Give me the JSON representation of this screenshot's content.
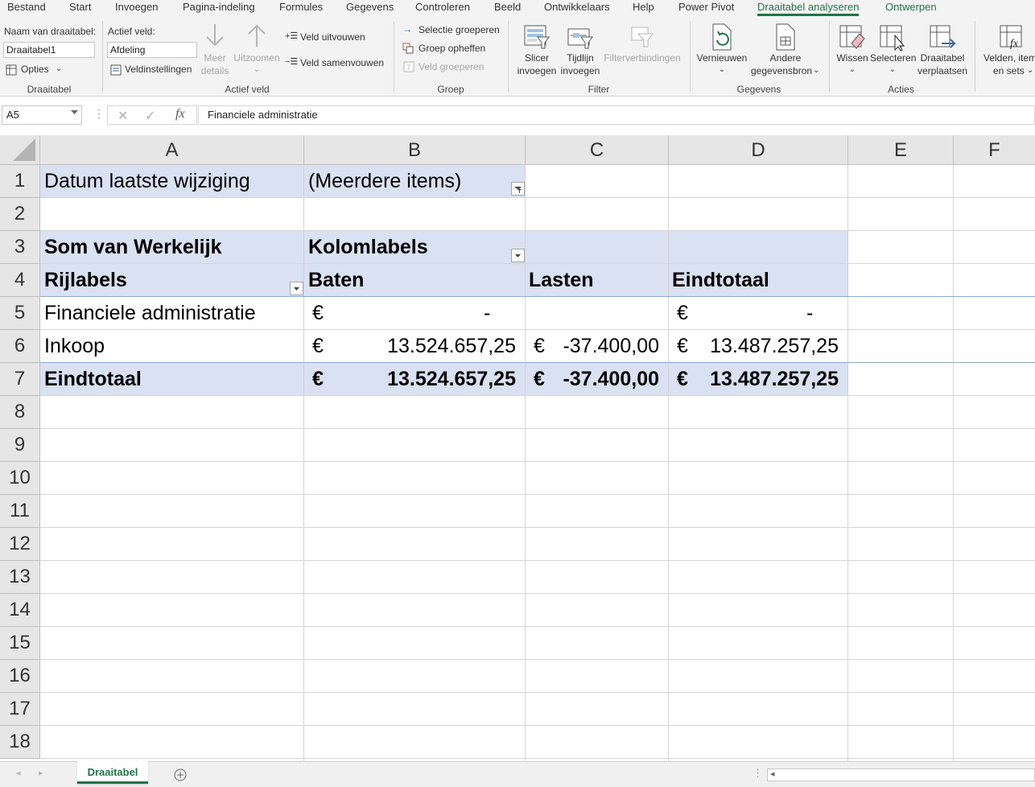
{
  "ribbon_tabs": [
    "Bestand",
    "Start",
    "Invoegen",
    "Pagina-indeling",
    "Formules",
    "Gegevens",
    "Controleren",
    "Beeld",
    "Ontwikkelaars",
    "Help",
    "Power Pivot",
    "Draaitabel analyseren",
    "Ontwerpen"
  ],
  "active_tab": "Draaitabel analyseren",
  "accent_color": "#217346",
  "ribbon": {
    "draaitabel": {
      "name_label": "Naam van draaitabel:",
      "name_value": "Draaitabel1",
      "options_label": "Opties",
      "group_label": "Draaitabel"
    },
    "actief_veld": {
      "field_label": "Actief veld:",
      "field_value": "Afdeling",
      "settings_label": "Veldinstellingen",
      "drill_down_1": "Meer",
      "drill_down_2": "details",
      "drill_up": "Uitzoomen",
      "expand_label": "Veld uitvouwen",
      "collapse_label": "Veld samenvouwen",
      "group_label": "Actief veld"
    },
    "groep": {
      "group_selection": "Selectie groeperen",
      "ungroup": "Groep opheffen",
      "group_field": "Veld groeperen",
      "group_label": "Groep"
    },
    "filter": {
      "slicer_1": "Slicer",
      "slicer_2": "invoegen",
      "timeline_1": "Tijdlijn",
      "timeline_2": "invoegen",
      "connections": "Filterverbindingen",
      "group_label": "Filter"
    },
    "gegevens": {
      "refresh": "Vernieuwen",
      "source_1": "Andere",
      "source_2": "gegevensbron",
      "group_label": "Gegevens"
    },
    "acties": {
      "clear": "Wissen",
      "select": "Selecteren",
      "move_1": "Draaitabel",
      "move_2": "verplaatsen",
      "group_label": "Acties"
    },
    "berekeningen": {
      "fields_1": "Velden, items",
      "fields_2": "en sets"
    }
  },
  "formula_bar": {
    "name_box": "A5",
    "content": "Financiele administratie"
  },
  "columns": [
    "A",
    "B",
    "C",
    "D",
    "E",
    "F"
  ],
  "rows": [
    "1",
    "2",
    "3",
    "4",
    "5",
    "6",
    "7",
    "8",
    "9",
    "10",
    "11",
    "12",
    "13",
    "14",
    "15",
    "16",
    "17",
    "18"
  ],
  "pivot": {
    "filter_label": "Datum laatste wijziging",
    "filter_value": "(Meerdere items)",
    "value_header": "Som van Werkelijk",
    "column_labels": "Kolomlabels",
    "row_labels": "Rijlabels",
    "col_baten": "Baten",
    "col_lasten": "Lasten",
    "col_total": "Eindtotaal",
    "currency": "€",
    "dash": "-",
    "rows": [
      {
        "label": "Financiele administratie",
        "baten": "-",
        "lasten": "",
        "total": "-"
      },
      {
        "label": "Inkoop",
        "baten": "13.524.657,25",
        "lasten": "-37.400,00",
        "total": "13.487.257,25"
      }
    ],
    "grand_total": {
      "label": "Eindtotaal",
      "baten": "13.524.657,25",
      "lasten": "-37.400,00",
      "total": "13.487.257,25"
    }
  },
  "sheets": [
    "Draaitabel"
  ]
}
